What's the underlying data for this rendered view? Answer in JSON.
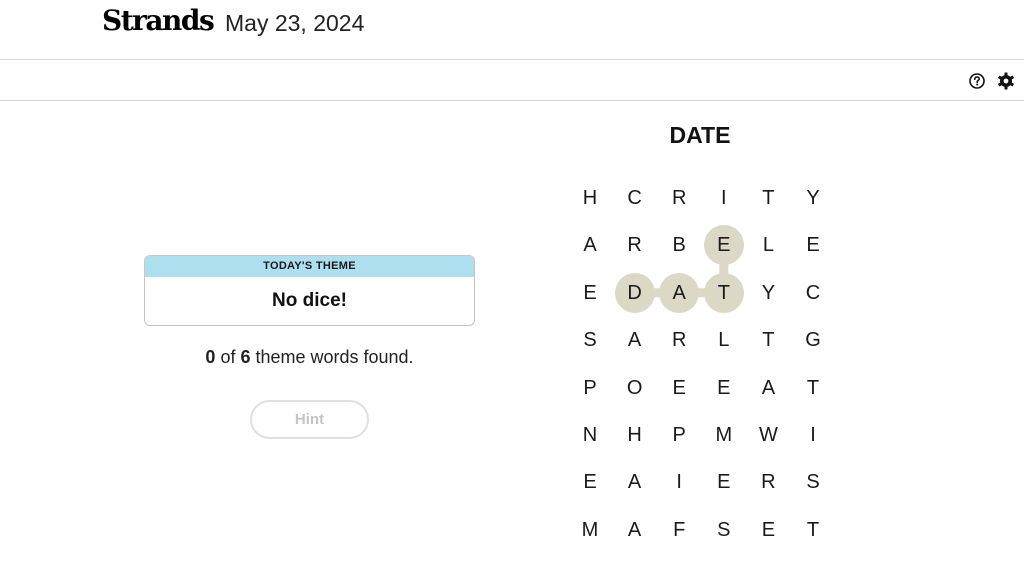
{
  "header": {
    "logo": "Strands",
    "date": "May 23, 2024"
  },
  "toolbar": {
    "help_icon": "question-circle-icon",
    "settings_icon": "gear-icon"
  },
  "theme": {
    "label": "TODAY'S THEME",
    "value": "No dice!",
    "label_bg": "#aedfee"
  },
  "progress": {
    "found": "0",
    "of_text": " of ",
    "total": "6",
    "suffix": " theme words found."
  },
  "hint": {
    "label": "Hint"
  },
  "current_word": "DATE",
  "board": {
    "rows": [
      [
        "H",
        "C",
        "R",
        "I",
        "T",
        "Y"
      ],
      [
        "A",
        "R",
        "B",
        "E",
        "L",
        "E"
      ],
      [
        "E",
        "D",
        "A",
        "T",
        "Y",
        "C"
      ],
      [
        "S",
        "A",
        "R",
        "L",
        "T",
        "G"
      ],
      [
        "P",
        "O",
        "E",
        "E",
        "A",
        "T"
      ],
      [
        "N",
        "H",
        "P",
        "M",
        "W",
        "I"
      ],
      [
        "E",
        "A",
        "I",
        "E",
        "R",
        "S"
      ],
      [
        "M",
        "A",
        "F",
        "S",
        "E",
        "T"
      ]
    ],
    "selected_path": [
      [
        2,
        1
      ],
      [
        2,
        2
      ],
      [
        2,
        3
      ],
      [
        1,
        3
      ]
    ],
    "selected_color": "#dbd8c5"
  }
}
